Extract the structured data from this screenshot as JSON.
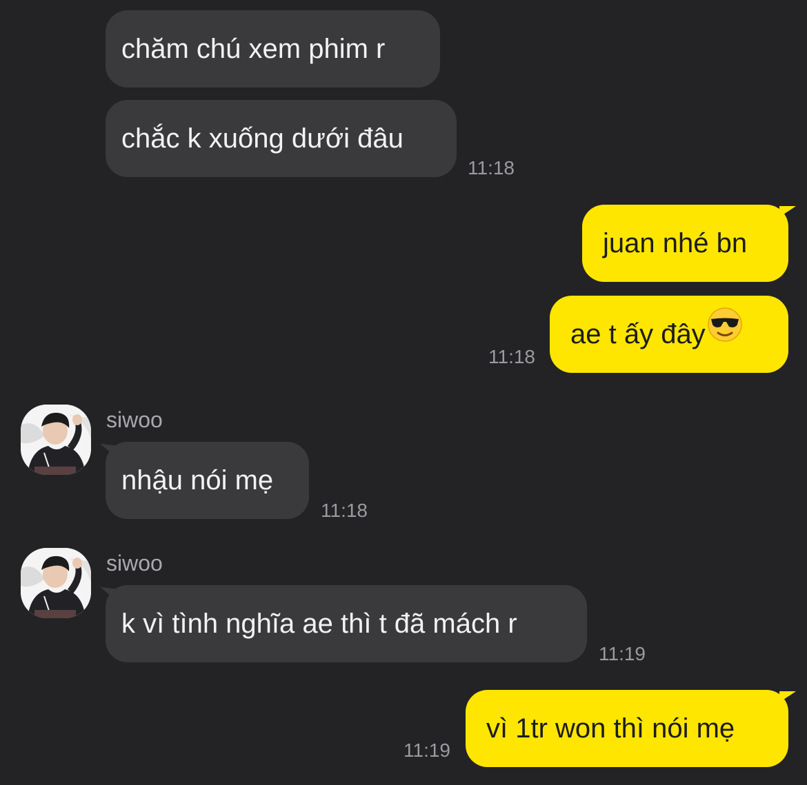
{
  "messages": [
    {
      "text": "chăm chú xem phim r"
    },
    {
      "text": "chắc k xuống dưới đâu",
      "time": "11:18"
    },
    {
      "text": "juan nhé bn"
    },
    {
      "text": "ae t ấy đây",
      "emoji": "smiling-face-with-sunglasses-icon",
      "time": "11:18"
    },
    {
      "sender": "siwoo",
      "text": "nhậu nói mẹ",
      "time": "11:18"
    },
    {
      "sender": "siwoo",
      "text": "k vì tình nghĩa ae thì t đã mách r",
      "time": "11:19"
    },
    {
      "text": "vì 1tr won thì nói mẹ",
      "time": "11:19"
    }
  ],
  "colors": {
    "background": "#232326",
    "incoming_bubble": "#3a3a3d",
    "outgoing_bubble": "#ffe600",
    "timestamp": "#9a9aa0"
  }
}
